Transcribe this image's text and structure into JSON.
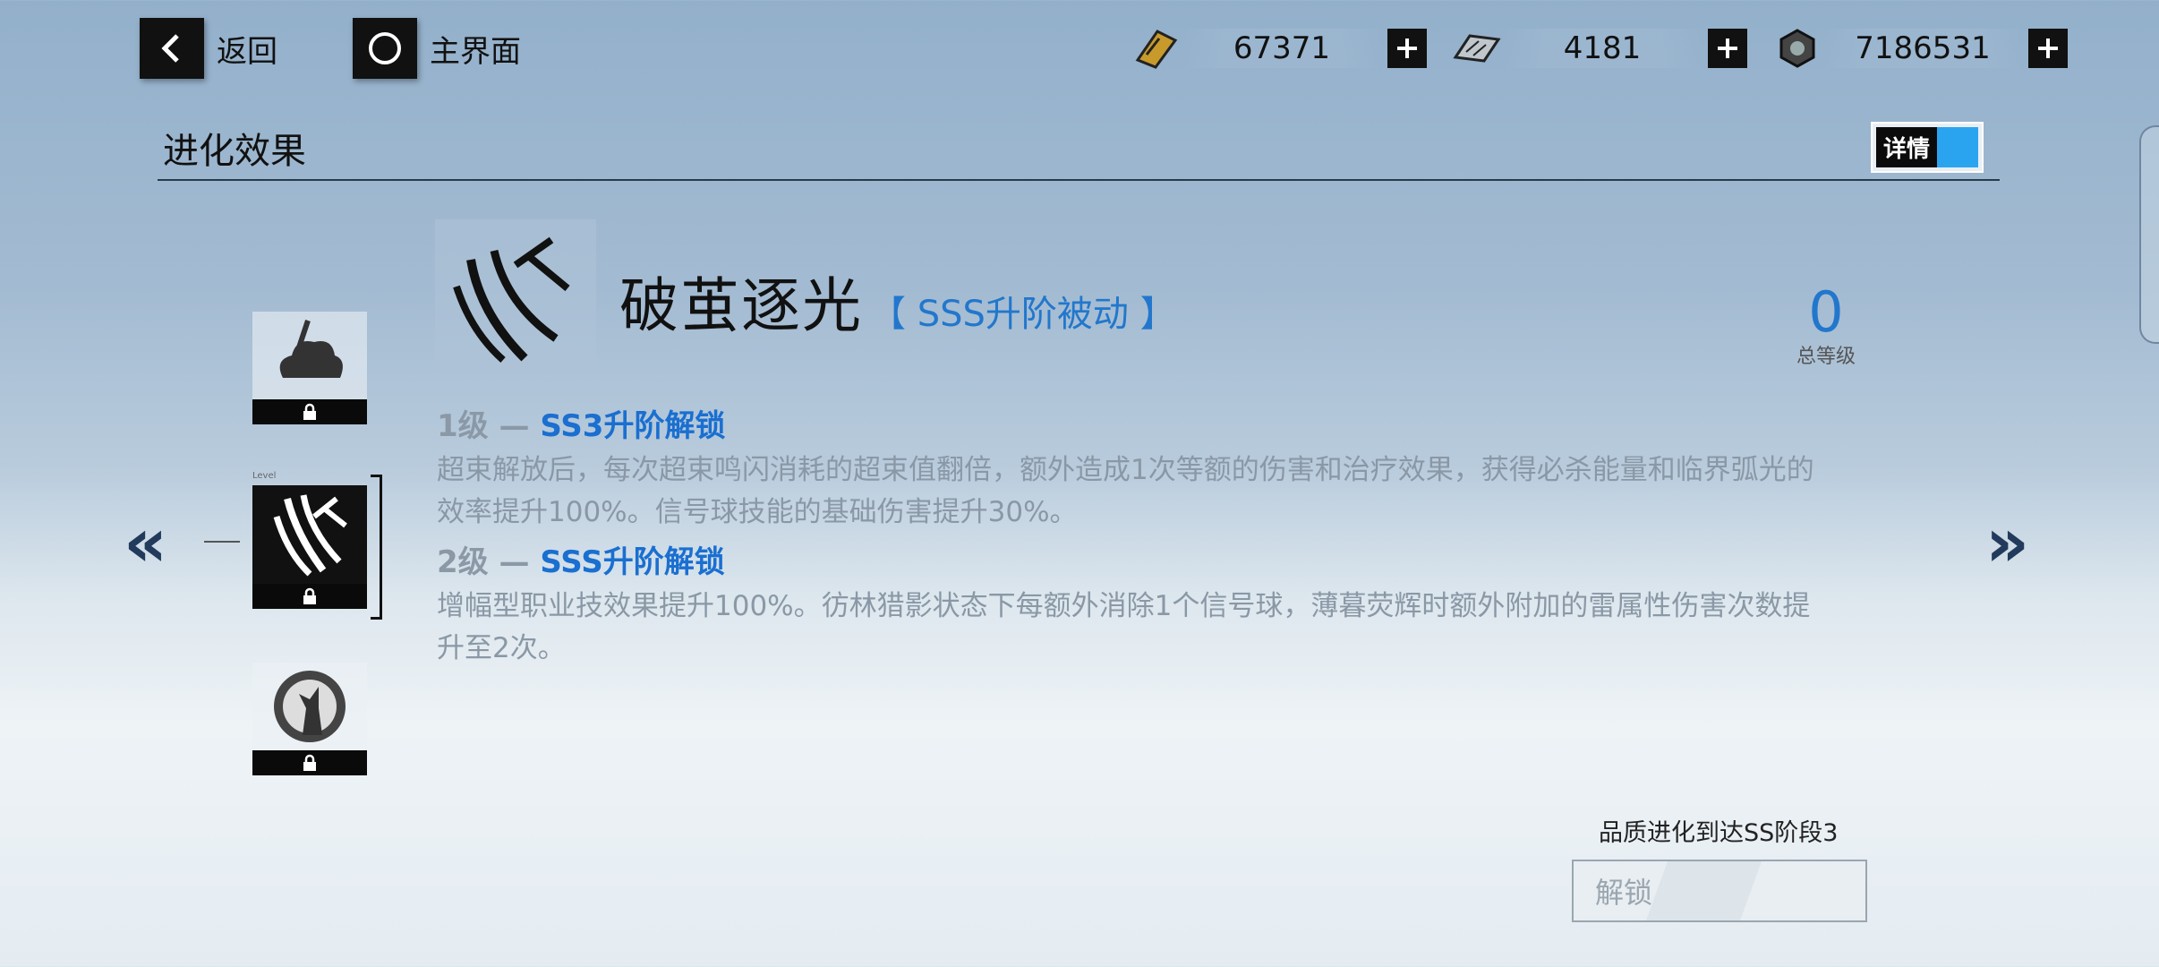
{
  "nav": {
    "back_label": "返回",
    "home_label": "主界面"
  },
  "resources": [
    {
      "icon": "gold-ticket-icon",
      "value": "67371"
    },
    {
      "icon": "chip-card-icon",
      "value": "4181"
    },
    {
      "icon": "nut-part-icon",
      "value": "7186531"
    }
  ],
  "section": {
    "title": "进化效果",
    "detail_toggle_label": "详情"
  },
  "skill": {
    "name": "破茧逐光",
    "tag": "【 SSS升阶被动 】",
    "total_level": "0",
    "total_level_caption": "总等级",
    "tiers": [
      {
        "prefix": "1级 — ",
        "title": "SS3升阶解锁",
        "desc": "超束解放后，每次超束鸣闪消耗的超束值翻倍，额外造成1次等额的伤害和治疗效果，获得必杀能量和临界弧光的效率提升100%。信号球技能的基础伤害提升30%。"
      },
      {
        "prefix": "2级 — ",
        "title": "SSS升阶解锁",
        "desc": "增幅型职业技效果提升100%。彷林猎影状态下每额外消除1个信号球，薄暮荧辉时额外附加的雷属性伤害次数提升至2次。"
      }
    ]
  },
  "thumbs": [
    {
      "icon": "lightning-cloud-icon"
    },
    {
      "icon": "claw-slash-icon",
      "caption": "Level"
    },
    {
      "icon": "wolf-moon-icon"
    }
  ],
  "unlock": {
    "requirement": "品质进化到达SS阶段3",
    "button_label": "解锁"
  },
  "colors": {
    "accent": "#2277cc",
    "toggle_on": "#2aa4ef"
  }
}
